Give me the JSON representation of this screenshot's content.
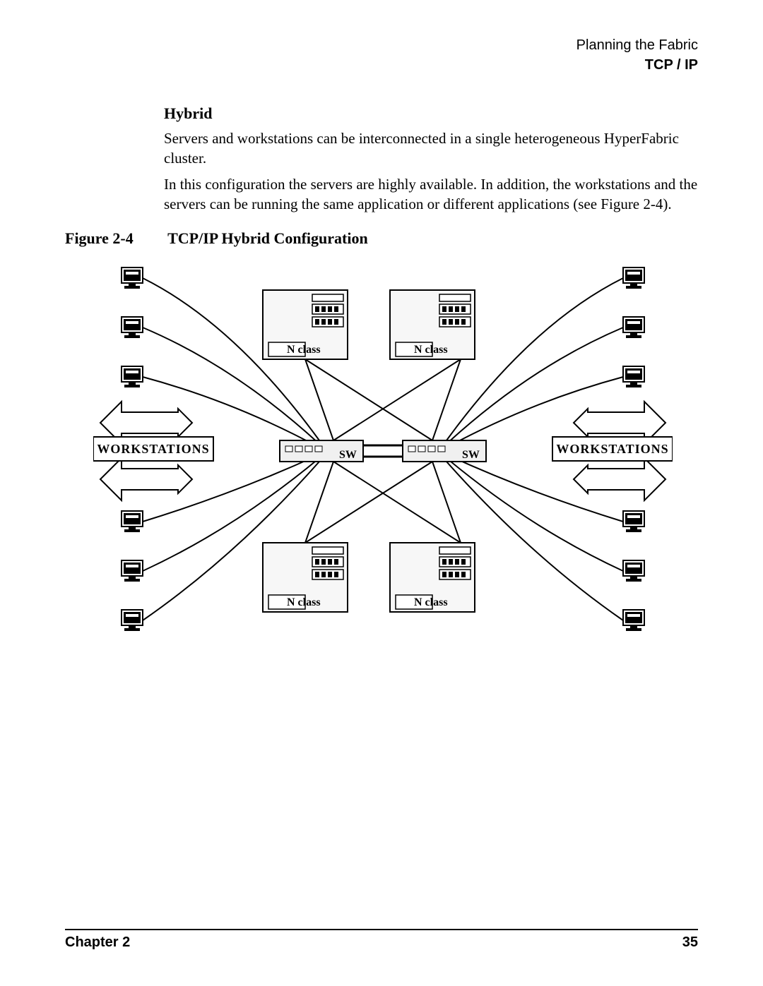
{
  "header": {
    "line1": "Planning the Fabric",
    "line2": "TCP / IP"
  },
  "section": {
    "heading": "Hybrid",
    "para1": "Servers and workstations can be interconnected in a single heterogeneous HyperFabric cluster.",
    "para2": "In this configuration the servers are highly available. In addition, the workstations and the servers can be running the same application or different applications (see Figure 2-4)."
  },
  "figure": {
    "label": "Figure 2-4",
    "title": "TCP/IP Hybrid Configuration",
    "labels": {
      "workstations": "WORKSTATIONS",
      "nclass": "N class",
      "sw": "SW"
    }
  },
  "footer": {
    "chapter": "Chapter 2",
    "page": "35"
  }
}
